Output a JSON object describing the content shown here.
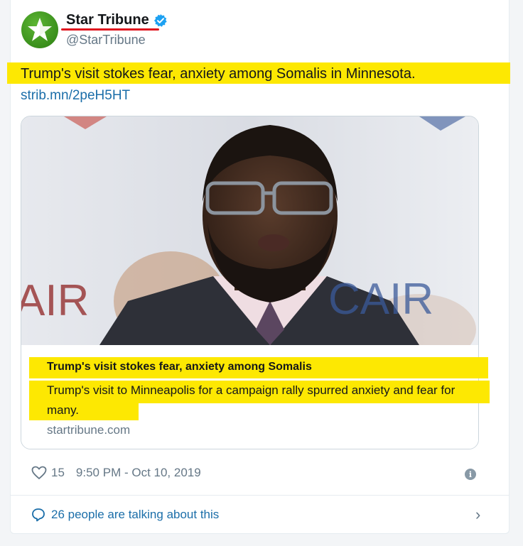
{
  "account": {
    "name": "Star Tribune",
    "handle": "@StarTribune",
    "verified": true,
    "avatar_icon": "star-logo-icon",
    "avatar_color": "#3a8f1c"
  },
  "tweet": {
    "text": "Trump's visit stokes fear, anxiety among Somalis in Minnesota.",
    "link": "strib.mn/2peH5HT"
  },
  "link_card": {
    "image_signs": [
      "AIR",
      "CAIR"
    ],
    "title": "Trump's visit stokes fear, anxiety among Somalis",
    "description": "Trump's visit to Minneapolis for a campaign rally spurred anxiety and fear for many.",
    "domain": "startribune.com"
  },
  "meta": {
    "like_count": "15",
    "timestamp": "9:50 PM - Oct 10, 2019"
  },
  "footer": {
    "talking_label": "26 people are talking about this"
  },
  "colors": {
    "highlight": "#fde802",
    "underline": "#e0141e",
    "link": "#1b6ea9",
    "verified": "#1da1f2"
  }
}
